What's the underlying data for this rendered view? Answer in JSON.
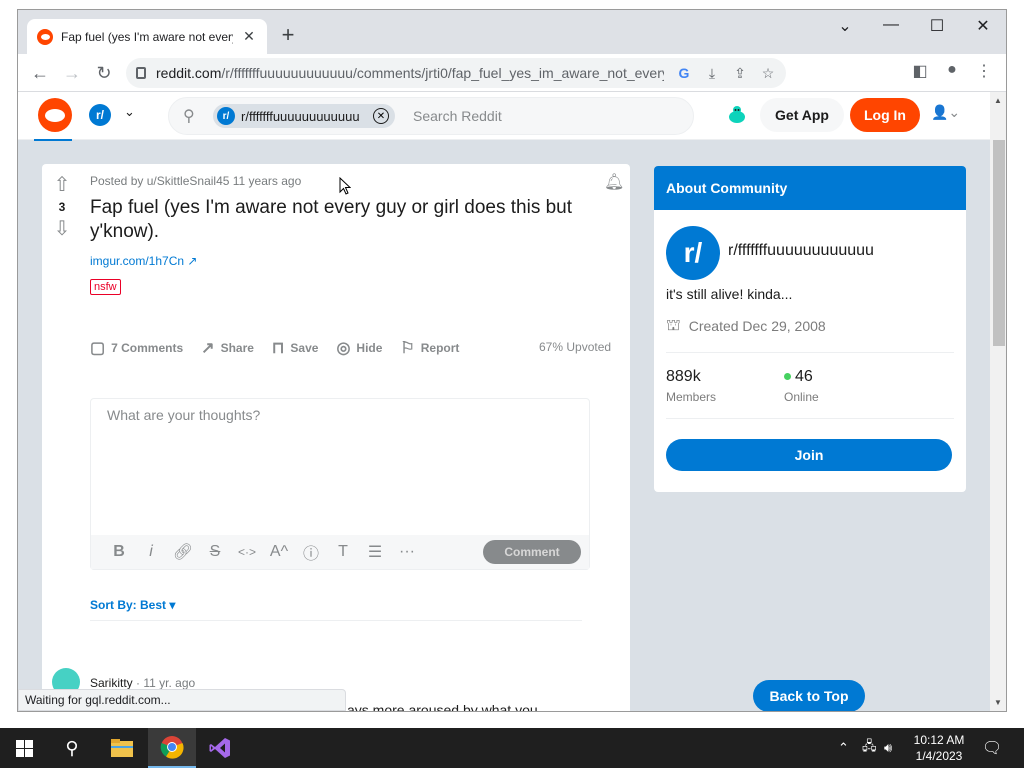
{
  "browser": {
    "tab_title": "Fap fuel (yes I'm aware not every",
    "tab_close": "✕",
    "new_tab": "+",
    "url_host": "reddit.com",
    "url_path": "/r/fffffffuuuuuuuuuuuu/comments/jrti0/fap_fuel_yes_im_aware_not_every_guy_or_gir...",
    "status_text": "Waiting for gql.reddit.com..."
  },
  "header": {
    "search_chip": "r/fffffffuuuuuuuuuuuu",
    "search_placeholder": "Search Reddit",
    "get_app": "Get App",
    "log_in": "Log In",
    "sub_icon": "r/"
  },
  "post": {
    "meta": "Posted by u/SkittleSnail45 11 years ago",
    "score": "3",
    "title": "Fap fuel (yes I'm aware not every guy or girl does this but y'know).",
    "link": "imgur.com/1h7Cn",
    "flair": "nsfw",
    "actions": {
      "comments": "7 Comments",
      "share": "Share",
      "save": "Save",
      "hide": "Hide",
      "report": "Report"
    },
    "upvoted": "67% Upvoted",
    "comment_placeholder": "What are your thoughts?",
    "comment_button": "Comment",
    "sort_by": "Sort By: Best",
    "first_comment": {
      "author": "Sarikitty",
      "age": "· 11 yr. ago",
      "text": "ays more aroused by what you"
    }
  },
  "sidebar": {
    "heading": "About Community",
    "icon_text": "r/",
    "name": "r/fffffffuuuuuuuuuuuu",
    "description": "it's still alive! kinda...",
    "created": "Created Dec 29, 2008",
    "members_value": "889k",
    "members_label": "Members",
    "online_value": "46",
    "online_label": "Online",
    "join": "Join",
    "back_to_top": "Back to Top"
  },
  "taskbar": {
    "time": "10:12 AM",
    "date": "1/4/2023"
  },
  "colors": {
    "reddit_orange": "#ff4500",
    "reddit_blue": "#0079d3",
    "online_green": "#46d160"
  }
}
